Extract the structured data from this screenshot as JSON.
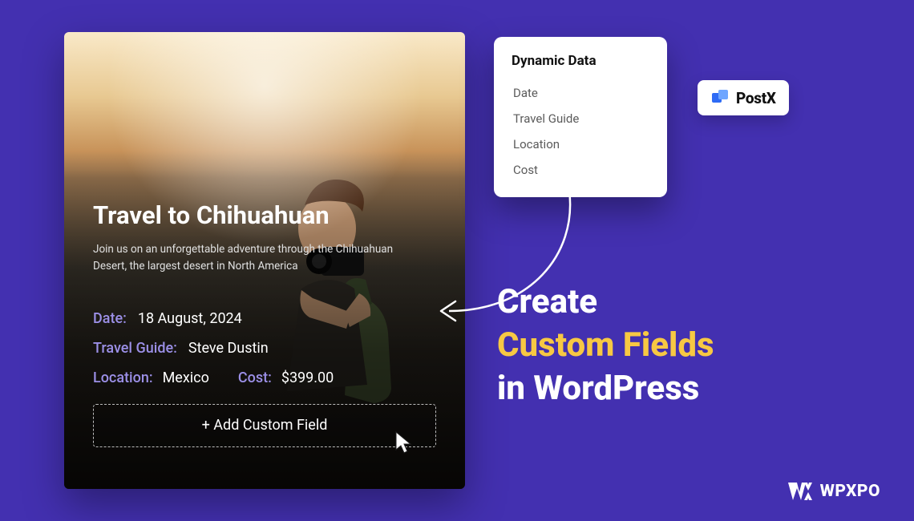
{
  "card": {
    "title": "Travel to Chihuahuan",
    "description": "Join us on an unforgettable adventure through the Chihuahuan Desert, the largest desert in North America",
    "date_label": "Date:",
    "date_value": "18 August, 2024",
    "guide_label": "Travel Guide:",
    "guide_value": "Steve Dustin",
    "location_label": "Location:",
    "location_value": "Mexico",
    "cost_label": "Cost:",
    "cost_value": "$399.00",
    "add_button": "+ Add Custom Field"
  },
  "popup": {
    "title": "Dynamic Data",
    "items": [
      "Date",
      "Travel Guide",
      "Location",
      "Cost"
    ]
  },
  "headline": {
    "line1": "Create",
    "line2": "Custom Fields",
    "line3": "in WordPress"
  },
  "brands": {
    "postx": "PostX",
    "wpxpo": "WPXPO"
  }
}
